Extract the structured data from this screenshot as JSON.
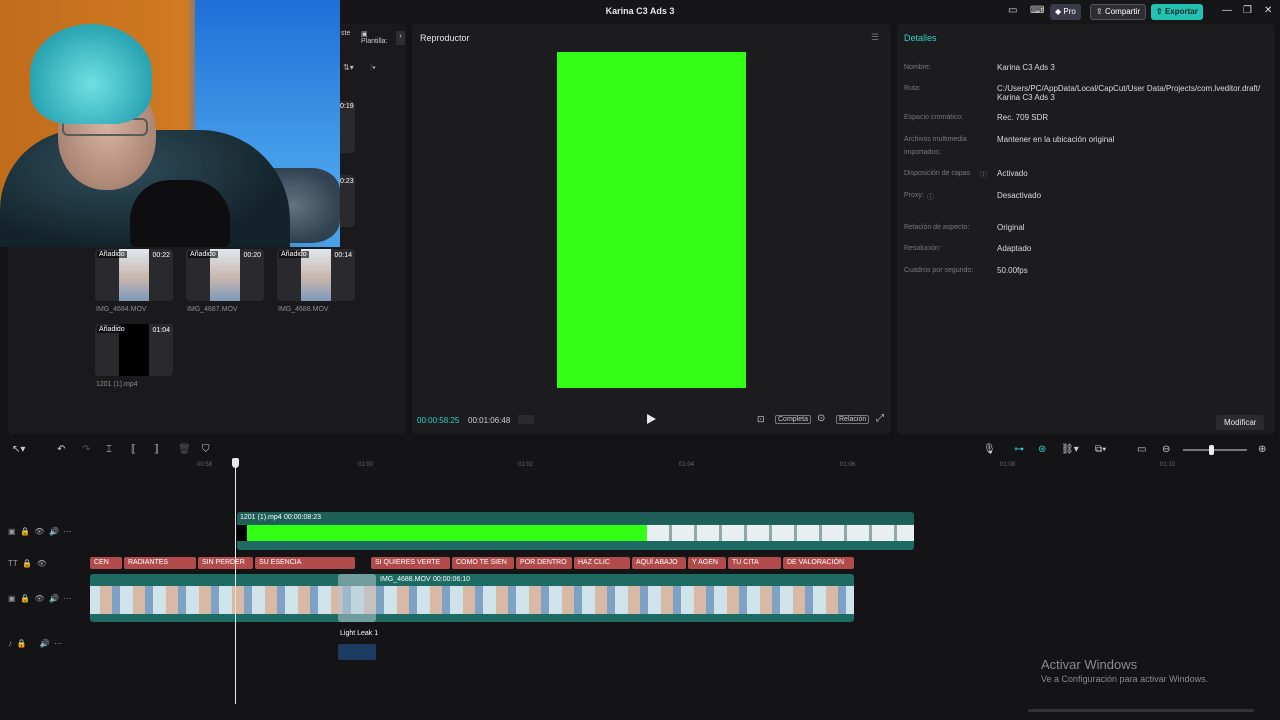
{
  "titlebar": {
    "title": "Karina C3 Ads 3",
    "pro": "Pro",
    "share": "Compartir",
    "export": "Exportar"
  },
  "media": {
    "tabs": [
      "ste",
      "Plantilla:"
    ],
    "partial_durations": [
      "0:19",
      "0:23"
    ],
    "items": [
      {
        "badge": "Añadido",
        "duration": "00:22",
        "name": "IMG_4684.MOV"
      },
      {
        "badge": "Añadido",
        "duration": "00:20",
        "name": "IMG_4687.MOV"
      },
      {
        "badge": "Añadido",
        "duration": "00:14",
        "name": "IMG_4688.MOV"
      },
      {
        "badge": "Añadido",
        "duration": "01:04",
        "name": "1201 (1).mp4"
      }
    ]
  },
  "player": {
    "title": "Reproductor",
    "current": "00:00:58:25",
    "total": "00:01:06:48",
    "full": "Completa",
    "ratio": "Relación"
  },
  "details": {
    "title": "Detalles",
    "rows": [
      {
        "label": "Nombre:",
        "value": "Karina C3 Ads 3"
      },
      {
        "label": "Ruta:",
        "value": "C:/Users/PC/AppData/Local/CapCut/User Data/Projects/com.lveditor.draft/",
        "value2": "Karina C3 Ads 3"
      },
      {
        "label": "Espacio cromático:",
        "value": "Rec. 709 SDR"
      },
      {
        "label": "Archivos multimedia",
        "label2": "importados:",
        "value": "Mantener en la ubicación original"
      },
      {
        "label": "Disposición de capas",
        "value": "Activado"
      },
      {
        "label": "Proxy:",
        "value": "Desactivado"
      },
      {
        "label": "Relación de aspecto:",
        "value": "Original"
      },
      {
        "label": "Resolución:",
        "value": "Adaptado"
      },
      {
        "label": "Cuadros por segundo:",
        "value": "50.00fps"
      }
    ],
    "modify": "Modificar"
  },
  "timeline": {
    "ruler": [
      "00:58",
      "01:00",
      "01:02",
      "01:04",
      "01:06",
      "01:08",
      "01:10"
    ],
    "green_clip": {
      "name": "1201 (1).mp4",
      "duration": "00:00:08:23"
    },
    "main_clip": {
      "name": "IMG_4688.MOV",
      "duration": "00:00:06:10"
    },
    "effect_label": "Light Leak 1",
    "text_clips": [
      "CEN",
      "RADIANTES",
      "SIN PERDER",
      "SU ESENCIA",
      "SI QUIERES VERTE",
      "COMO TE SIEN",
      "POR DENTRO",
      "HAZ CLIC",
      "AQUÍ ABAJO",
      "Y AGEN",
      "TU CITA",
      "DE VALORACIÓN"
    ]
  },
  "watermark": {
    "line1": "Activar Windows",
    "line2": "Ve a Configuración para activar Windows."
  },
  "colors": {
    "accent": "#23c1b1",
    "chroma": "#33ff14",
    "text_clip": "#b24c4c",
    "video_clip": "#1e6b63"
  }
}
